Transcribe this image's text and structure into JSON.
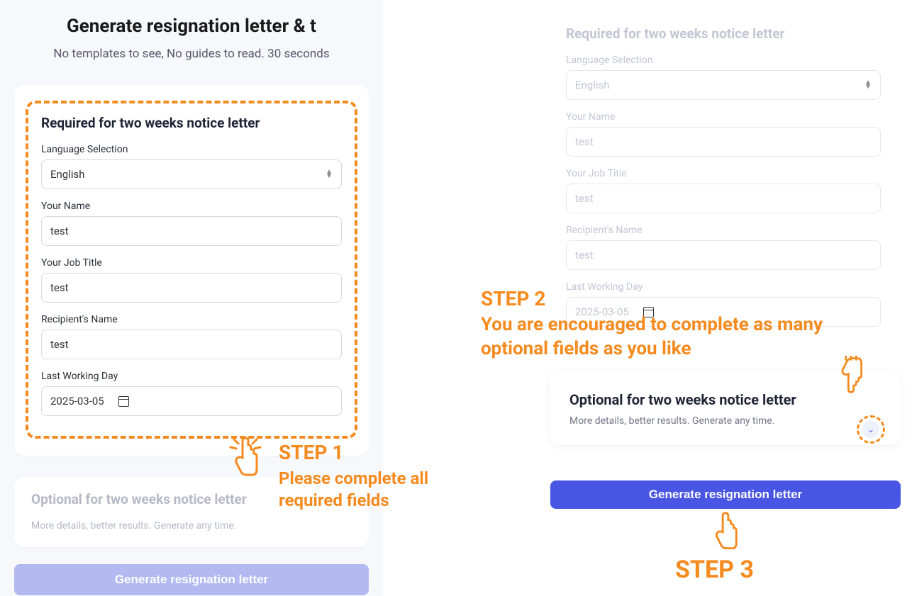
{
  "page": {
    "title": "Generate resignation letter & t",
    "subtitle": "No templates to see, No guides to read. 30 seconds"
  },
  "left": {
    "required_title": "Required for two weeks notice letter",
    "language_label": "Language Selection",
    "language_value": "English",
    "name_label": "Your Name",
    "name_value": "test",
    "jobtitle_label": "Your Job Title",
    "jobtitle_value": "test",
    "recipient_label": "Recipient's Name",
    "recipient_value": "test",
    "lastday_label": "Last Working Day",
    "lastday_value": "2025-03-05",
    "optional_title": "Optional for two weeks notice letter",
    "optional_sub": "More details, better results. Generate any time.",
    "generate_label": "Generate resignation letter"
  },
  "right": {
    "required_title": "Required for two weeks notice letter",
    "language_label": "Language Selection",
    "language_value": "English",
    "name_label": "Your Name",
    "name_value": "test",
    "jobtitle_label": "Your Job Title",
    "jobtitle_value": "test",
    "recipient_label": "Recipient's Name",
    "recipient_value": "test",
    "lastday_label": "Last Working Day",
    "lastday_value": "2025-03-05",
    "optional_title": "Optional for two weeks notice letter",
    "optional_sub": "More details, better results. Generate any time.",
    "generate_label": "Generate resignation letter"
  },
  "annotations": {
    "step1_label": "STEP 1",
    "step1_text": "Please complete all required fields",
    "step2_label": "STEP 2",
    "step2_text": "You are encouraged to complete as many optional fields as you like",
    "step3_label": "STEP 3"
  }
}
